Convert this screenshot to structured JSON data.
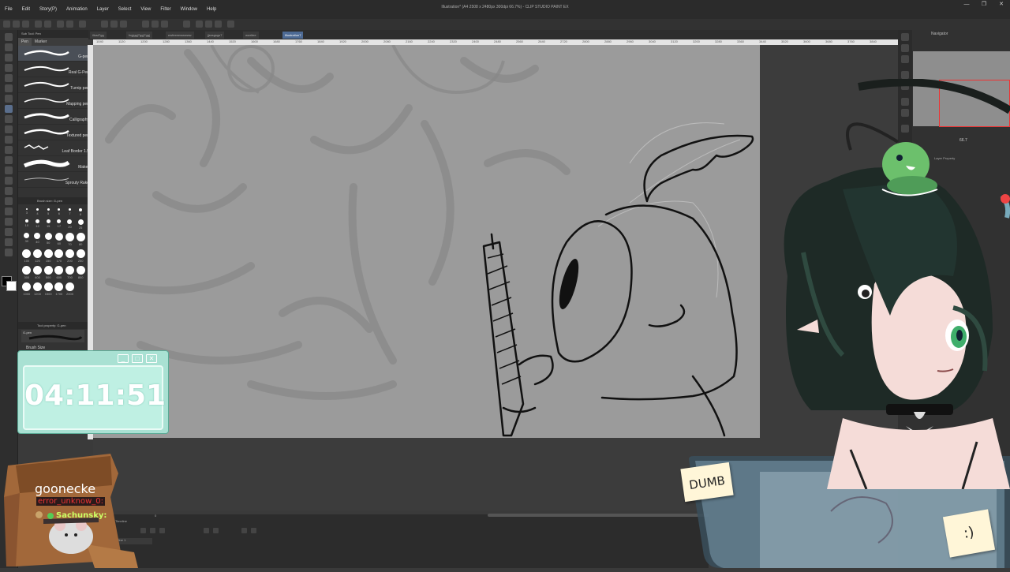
{
  "window": {
    "title": "Illustration* (A4 2508 x 2480px 300dpi 66.7%) - CLIP STUDIO PAINT EX",
    "controls": [
      "—",
      "❐",
      "✕"
    ]
  },
  "menu": [
    "File",
    "Edit",
    "Story(P)",
    "Animation",
    "Layer",
    "Select",
    "View",
    "Filter",
    "Window",
    "Help"
  ],
  "doc_tabs": [
    "illust7gg",
    "fogjggj7ggj7ggj",
    "ewfeeeewwwww",
    "jjsssgsgs7",
    "wwritee",
    "Illustration7"
  ],
  "ruler_ticks": [
    "1040",
    "1120",
    "1200",
    "1280",
    "1360",
    "1440",
    "1520",
    "1600",
    "1680",
    "1760",
    "1840",
    "1920",
    "2000",
    "2080",
    "2160",
    "2240",
    "2320",
    "2400",
    "2480",
    "2560",
    "2640",
    "2720",
    "2800",
    "2880",
    "2960",
    "3040",
    "3120",
    "3200",
    "3280",
    "3360",
    "3440",
    "3520",
    "3600",
    "3680",
    "3760",
    "3840"
  ],
  "subtool": {
    "header": "Sub Tool: Pen",
    "tabs": [
      "Pen",
      "Marker"
    ],
    "brushes": [
      "G-pen",
      "Real G-Pen",
      "Turnip pen",
      "Mapping pen",
      "Calligraphy",
      "Textured pen",
      "Leaf Border 1.5",
      "Maker",
      "Sprouty Rake"
    ],
    "brush_size_header": "Brush size: G-pen",
    "sizes": [
      "3",
      "4",
      "5",
      "6",
      "7",
      "8",
      "10",
      "12",
      "15",
      "17",
      "20",
      "25",
      "30",
      "40",
      "50",
      "60",
      "70",
      "80",
      "100",
      "120",
      "150",
      "170",
      "200",
      "250",
      "300",
      "400",
      "500",
      "600",
      "700",
      "800",
      "1000",
      "1200",
      "1500",
      "1700",
      "2000"
    ],
    "tool_property_header": "Tool property: G-pen",
    "tool_property_label": "G-pen",
    "brush_size_label": "Brush Size"
  },
  "timer": {
    "time": "04:11:51",
    "buttons": [
      "_",
      "□",
      "✕"
    ]
  },
  "chat": {
    "user1": "goonecke",
    "user2": "error_unknow_0:",
    "user3": "Sachunsky:"
  },
  "right_panel": {
    "navigator_label": "Navigator",
    "zoom": "66.7",
    "layer_property_label": "Layer Property"
  },
  "timeline": {
    "header": "Timeline",
    "track": "Timeline 1",
    "frame": "0"
  },
  "stickies": {
    "note1": "DUMB",
    "note2": ":)"
  },
  "colors": {
    "menubar": "#2b2b2b",
    "panel": "#333333",
    "canvas": "#9b9b9b",
    "timer_bg": "#a9e1d3",
    "hair": "#1e2a26",
    "frog": "#6cc06c",
    "active_tab": "#4d6a94"
  }
}
